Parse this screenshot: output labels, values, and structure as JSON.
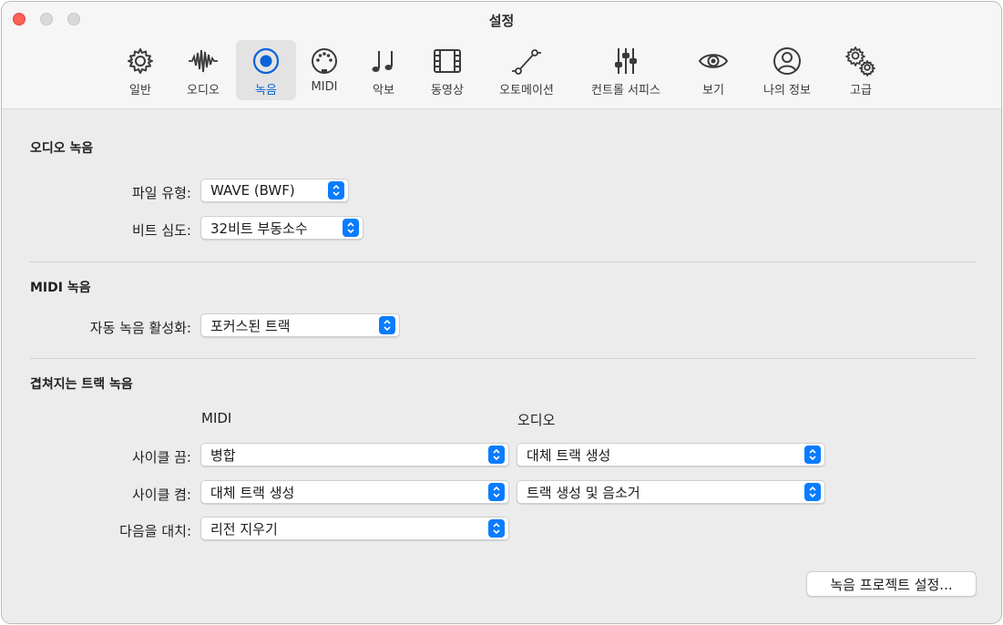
{
  "window": {
    "title": "설정"
  },
  "toolbar": {
    "tabs": [
      {
        "label": "일반",
        "icon": "gear-icon",
        "active": false
      },
      {
        "label": "오디오",
        "icon": "waveform-icon",
        "active": false
      },
      {
        "label": "녹음",
        "icon": "record-icon",
        "active": true
      },
      {
        "label": "MIDI",
        "icon": "midi-connector-icon",
        "active": false
      },
      {
        "label": "악보",
        "icon": "music-notes-icon",
        "active": false
      },
      {
        "label": "동영상",
        "icon": "film-strip-icon",
        "active": false
      },
      {
        "label": "오토메이션",
        "icon": "automation-curve-icon",
        "active": false
      },
      {
        "label": "컨트롤 서피스",
        "icon": "faders-icon",
        "active": false
      },
      {
        "label": "보기",
        "icon": "eye-icon",
        "active": false
      },
      {
        "label": "나의 정보",
        "icon": "person-icon",
        "active": false
      },
      {
        "label": "고급",
        "icon": "gears-icon",
        "active": false
      }
    ],
    "accent_color": "#0a63d8"
  },
  "audio_recording": {
    "title": "오디오 녹음",
    "file_type_label": "파일 유형:",
    "file_type_value": "WAVE (BWF)",
    "bit_depth_label": "비트 심도:",
    "bit_depth_value": "32비트 부동소수"
  },
  "midi_recording": {
    "title": "MIDI 녹음",
    "auto_enable_label": "자동 녹음 활성화:",
    "auto_enable_value": "포커스된 트랙"
  },
  "overlapping": {
    "title": "겹쳐지는 트랙 녹음",
    "midi_header": "MIDI",
    "audio_header": "오디오",
    "cycle_off_label": "사이클 끔:",
    "cycle_off_midi": "병합",
    "cycle_off_audio": "대체 트랙 생성",
    "cycle_on_label": "사이클 켬:",
    "cycle_on_midi": "대체 트랙 생성",
    "cycle_on_audio": "트랙 생성 및 음소거",
    "replace_label": "다음을 대치:",
    "replace_midi": "리전 지우기"
  },
  "footer": {
    "project_settings_button": "녹음 프로젝트 설정..."
  },
  "colors": {
    "stepper_blue": "#0a7cff",
    "close_red": "#fe5f57"
  }
}
